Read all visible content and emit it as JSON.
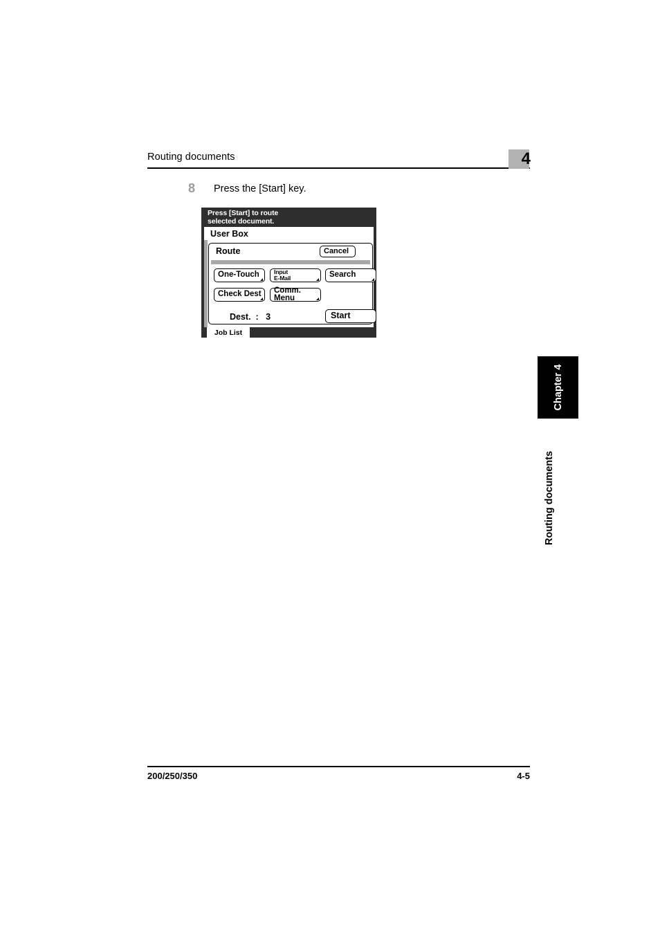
{
  "header": {
    "title": "Routing documents",
    "chapter_number": "4"
  },
  "step": {
    "number": "8",
    "text": "Press the [Start] key."
  },
  "lcd": {
    "message": "Press [Start] to route\nselected document.",
    "screen_title": "User Box",
    "card_title": "Route",
    "cancel_label": "Cancel",
    "keys": [
      {
        "label": "One-Touch"
      },
      {
        "label": "Input\nE-Mail"
      },
      {
        "label": "Search"
      },
      {
        "label": "Check Dest"
      },
      {
        "label": "Comm. Menu"
      }
    ],
    "dest_readout": "Dest.  :   3",
    "start_label": "Start",
    "job_list_label": "Job List",
    "colors": {
      "bezel": "#2e2e2e",
      "screen": "#ffffff",
      "rail": "#a8a8a8"
    }
  },
  "side_tabs": {
    "chapter": "Chapter 4",
    "section": "Routing documents"
  },
  "footer": {
    "model": "200/250/350",
    "page": "4-5"
  }
}
